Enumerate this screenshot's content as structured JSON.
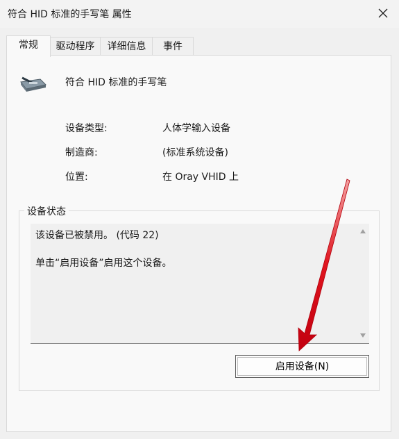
{
  "window": {
    "title": "符合 HID 标准的手写笔 属性"
  },
  "tabs": [
    {
      "label": "常规"
    },
    {
      "label": "驱动程序"
    },
    {
      "label": "详细信息"
    },
    {
      "label": "事件"
    }
  ],
  "device": {
    "name": "符合 HID 标准的手写笔",
    "icon": "pen-tablet-icon"
  },
  "properties": [
    {
      "label": "设备类型:",
      "value": "人体学输入设备"
    },
    {
      "label": "制造商:",
      "value": "(标准系统设备)"
    },
    {
      "label": "位置:",
      "value": "在 Oray VHID 上"
    }
  ],
  "status": {
    "group_label": "设备状态",
    "line1": "该设备已被禁用。 (代码 22)",
    "line2": "单击“启用设备”启用这个设备。"
  },
  "buttons": {
    "enable": "启用设备(N)"
  },
  "annotation": {
    "arrow_color": "#e0141e"
  }
}
